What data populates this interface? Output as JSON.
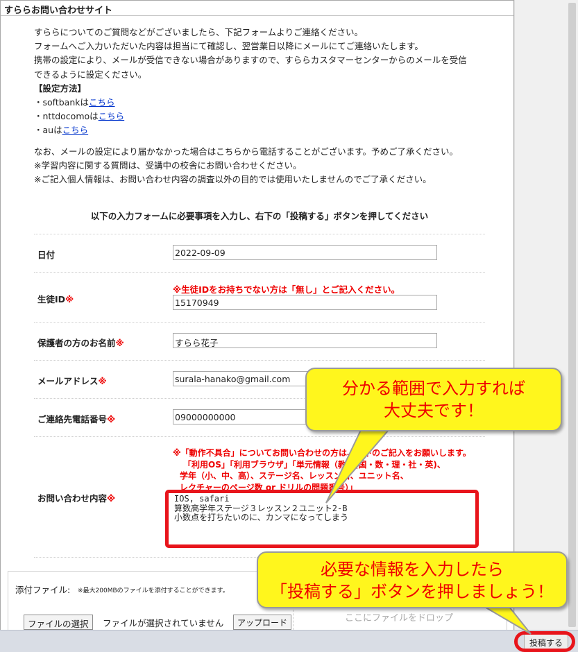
{
  "window_title": "すららお問い合わせサイト",
  "intro": {
    "line1": "すららについてのご質問などがございましたら、下記フォームよりご連絡ください。",
    "line2": "フォームへご入力いただいた内容は担当にて確認し、翌営業日以降にメールにてご連絡いたします。",
    "line3": "携帯の設定により、メールが受信できない場合がありますので、すららカスタマーセンターからのメールを受信",
    "line4": "できるように設定ください。",
    "settings_heading": "【設定方法】",
    "carriers": [
      {
        "prefix": "・softbankは",
        "link": "こちら"
      },
      {
        "prefix": "・nttdocomoは",
        "link": "こちら"
      },
      {
        "prefix": "・auは",
        "link": "こちら"
      }
    ],
    "note1": "なお、メールの設定により届かなかった場合はこちらから電話することがございます。予めご了承ください。",
    "note2": "※学習内容に関する質問は、受講中の校舎にお問い合わせください。",
    "note3": "※ご記入個人情報は、お問い合わせ内容の調査以外の目的では使用いたしませんのでご了承ください。"
  },
  "instruction": "以下の入力フォームに必要事項を入力し、右下の「投稿する」ボタンを押してください",
  "form": {
    "date": {
      "label": "日付",
      "value": "2022-09-09"
    },
    "student_id": {
      "label": "生徒ID",
      "required_mark": "※",
      "note": "※生徒IDをお持ちでない方は「無し」とご記入ください。",
      "value": "15170949"
    },
    "guardian_name": {
      "label": "保護者の方のお名前",
      "required_mark": "※",
      "value": "すらら花子"
    },
    "email": {
      "label": "メールアドレス",
      "required_mark": "※",
      "value": "surala-hanako@gmail.com"
    },
    "phone": {
      "label": "ご連絡先電話番号",
      "required_mark": "※",
      "value": "09000000000"
    },
    "inquiry": {
      "label": "お問い合わせ内容",
      "required_mark": "※",
      "notes": [
        "※「動作不具合」についてお問い合わせの方は、以下のご記入をお願いします。",
        "「利用OS」「利用ブラウザ」「単元情報（教科(国・数・理・社・英)、",
        "学年（小、中、高）、ステージ名、レッスン名、ユニット名、",
        "レクチャーのページ数 or ドリルの問題番号）」"
      ],
      "value": "IOS, safari\n算数高学年ステージ３レッスン２ユニット2-B\n小数点を打ちたいのに、カンマになってしまう"
    }
  },
  "attachment": {
    "label": "添付ファイル:",
    "note": "※最大200MBのファイルを添付することができます。",
    "choose_button": "ファイルの選択",
    "status": "ファイルが選択されていません",
    "upload_button": "アップロード",
    "drop_text": "ここにファイルをドロップ"
  },
  "submit_label": "投稿する",
  "callouts": {
    "top_line1": "分かる範囲で入力すれば",
    "top_line2": "大丈夫です！",
    "bottom_line1": "必要な情報を入力したら",
    "bottom_line2": "「投稿する」ボタンを押しましょう！"
  },
  "colors": {
    "required": "#e00000",
    "link": "#0033cc",
    "callout_bg": "#fff61d",
    "highlight": "#e8141b"
  }
}
